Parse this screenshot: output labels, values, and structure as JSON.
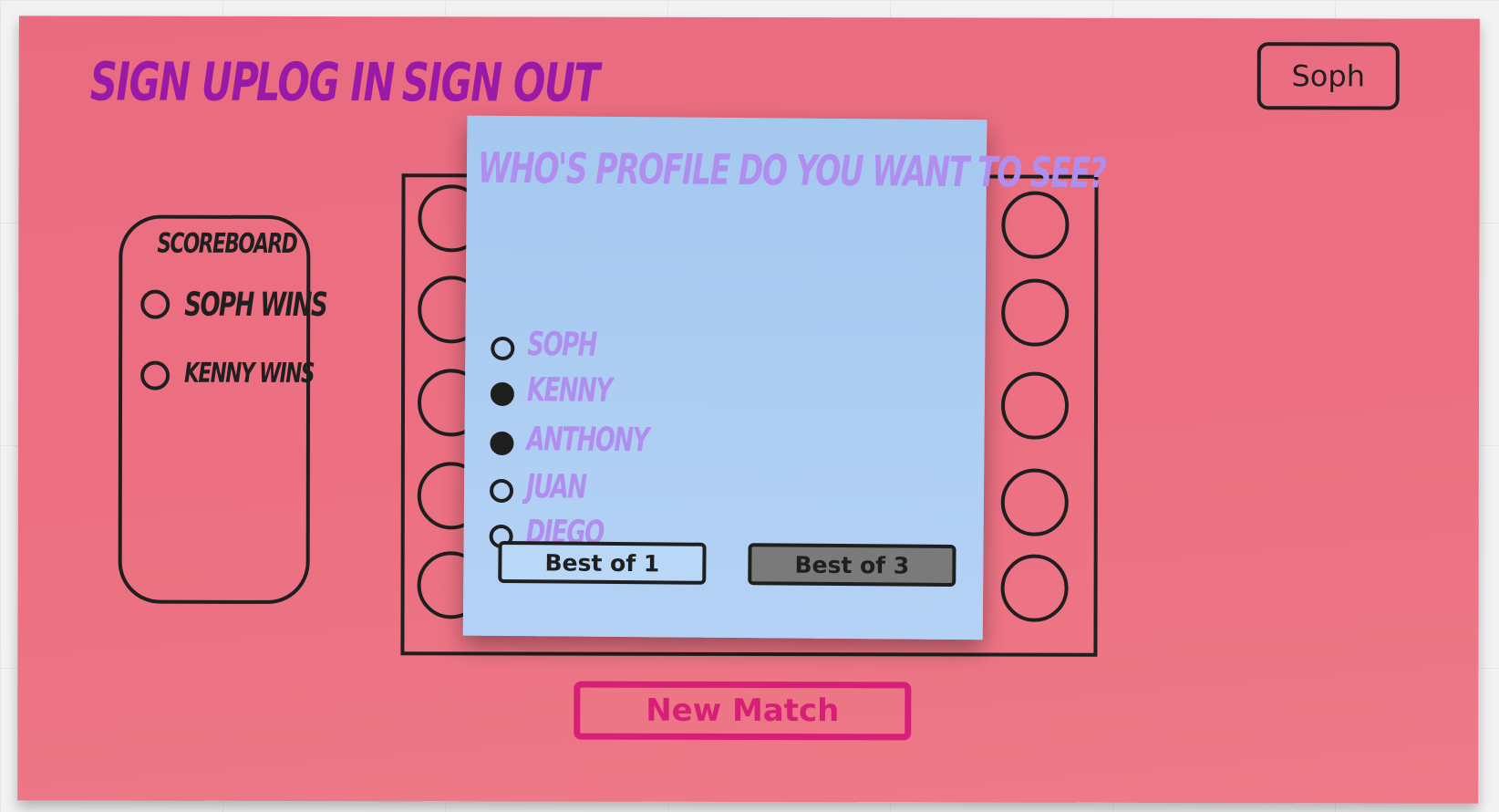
{
  "nav": {
    "sign_up": "SIGN UP",
    "log_in": "LOG IN",
    "sign_out": "SIGN OUT"
  },
  "user": {
    "name": "Soph"
  },
  "scoreboard": {
    "title": "SCOREBOARD",
    "rows": [
      {
        "label": "SOPH WINS"
      },
      {
        "label": "KENNY WINS"
      }
    ]
  },
  "modal": {
    "title": "WHO'S PROFILE DO YOU WANT TO SEE?",
    "options": [
      {
        "label": "SOPH",
        "checked": false
      },
      {
        "label": "KENNY",
        "checked": true
      },
      {
        "label": "ANTHONY",
        "checked": true
      },
      {
        "label": "JUAN",
        "checked": false
      },
      {
        "label": "DIEGO",
        "checked": false
      }
    ],
    "buttons": {
      "best_of_1": "Best of 1",
      "best_of_3": "Best of 3"
    }
  },
  "actions": {
    "new_match": "New Match"
  },
  "colors": {
    "board": "#ec6d80",
    "nav_text": "#9a1aa8",
    "modal_bg": "#a9cbf1",
    "modal_text": "#b08ef0",
    "accent": "#d81f78"
  }
}
